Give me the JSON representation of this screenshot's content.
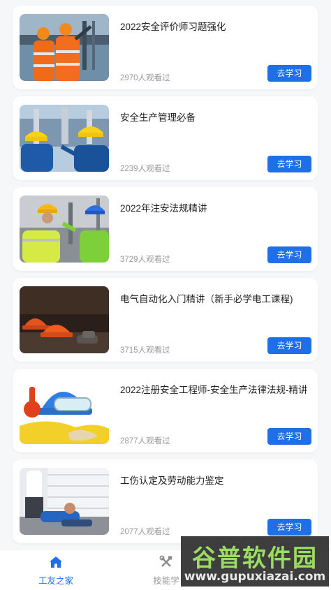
{
  "courses": [
    {
      "title": "2022安全评价师习题强化",
      "views": "2970人观看过",
      "action": "去学习",
      "image": "workers-safety-vests-photo"
    },
    {
      "title": "安全生产管理必备",
      "views": "2239人观看过",
      "action": "去学习",
      "image": "workers-hardhats-plant-photo"
    },
    {
      "title": "2022年注安法规精讲",
      "views": "3729人观看过",
      "action": "去学习",
      "image": "workers-yellow-blue-helmets-photo"
    },
    {
      "title": "电气自动化入门精讲（新手必学电工课程)",
      "views": "3715人观看过",
      "action": "去学习",
      "image": "orange-hardhats-photo"
    },
    {
      "title": "2022注册安全工程师-安全生产法律法规-精讲",
      "views": "2877人观看过",
      "action": "去学习",
      "image": "safety-gear-helmet-goggles-photo"
    },
    {
      "title": "工伤认定及劳动能力鉴定",
      "views": "2077人观看过",
      "action": "去学习",
      "image": "injured-worker-photo"
    }
  ],
  "tabbar": {
    "home_label": "工友之家",
    "skills_label": "技能学"
  },
  "watermark": {
    "logo": "谷普软件园",
    "url": "www.gupuxiazai.com"
  },
  "colors": {
    "accent": "#1f6fe8",
    "background": "#f6f7f9"
  }
}
